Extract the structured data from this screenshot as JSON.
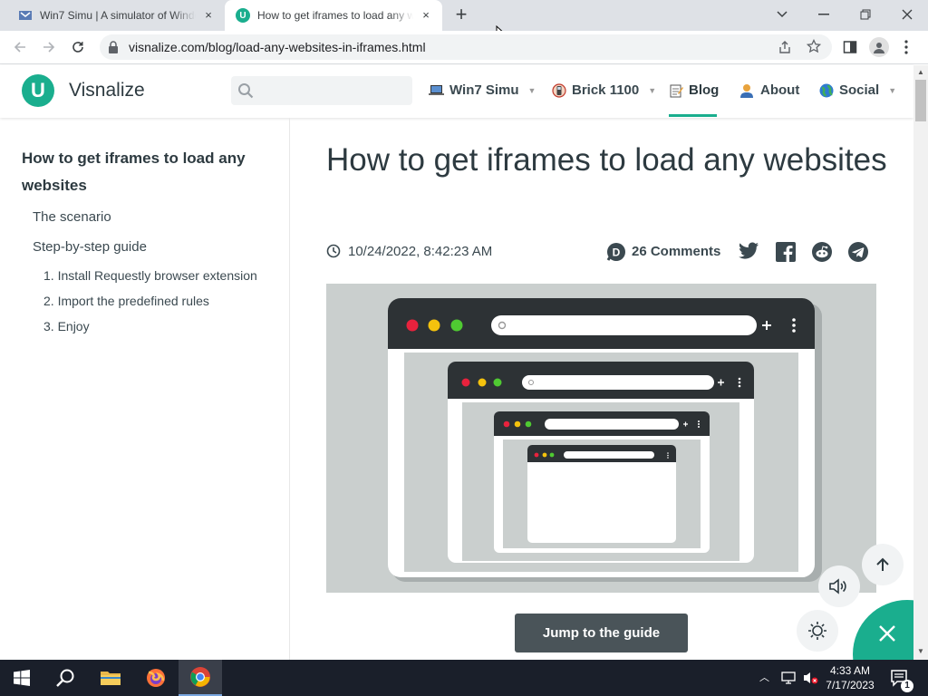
{
  "browser": {
    "tabs": [
      {
        "title": "Win7 Simu | A simulator of Windows 7",
        "close": "×"
      },
      {
        "title": "How to get iframes to load any websites",
        "close": "×"
      }
    ],
    "new_tab": "+",
    "url": "visnalize.com/blog/load-any-websites-in-iframes.html"
  },
  "site": {
    "logo_letter": "U",
    "brand": "Visnalize",
    "nav": [
      {
        "label": "Win7 Simu",
        "icon": "laptop-icon",
        "has_caret": true
      },
      {
        "label": "Brick 1100",
        "icon": "brick-phone-icon",
        "has_caret": true
      },
      {
        "label": "Blog",
        "icon": "notepad-icon",
        "active": true
      },
      {
        "label": "About",
        "icon": "person-icon"
      },
      {
        "label": "Social",
        "icon": "globe-icon",
        "has_caret": true
      }
    ],
    "accent": "#1aae8e"
  },
  "toc": {
    "title": "How to get iframes to load any websites",
    "items": [
      {
        "label": "The scenario"
      },
      {
        "label": "Step-by-step guide"
      },
      {
        "label": "1. Install Requestly browser extension"
      },
      {
        "label": "2. Import the predefined rules"
      },
      {
        "label": "3. Enjoy"
      }
    ]
  },
  "article": {
    "title": "How to get iframes to load any websites",
    "date": "10/24/2022, 8:42:23 AM",
    "comments": "26 Comments",
    "jump_button": "Jump to the guide"
  },
  "taskbar": {
    "time": "4:33 AM",
    "date": "7/17/2023",
    "notification_count": "1"
  }
}
